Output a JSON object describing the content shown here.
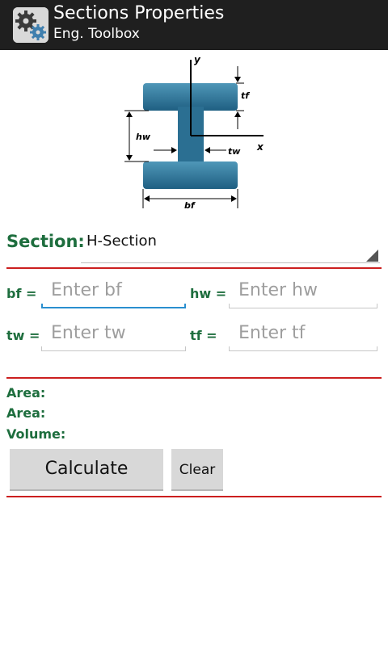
{
  "action_bar": {
    "title": "Sections Properties",
    "subtitle": "Eng. Toolbox",
    "icon": "gears-icon",
    "background": "#1f1f1f"
  },
  "diagram": {
    "labels": {
      "y": "y",
      "x": "x",
      "tf": "tf",
      "hw": "hw",
      "tw": "tw",
      "bf": "bf"
    },
    "fill": "#2b6f92"
  },
  "section": {
    "label": "Section:",
    "selected": "H-Section"
  },
  "inputs": {
    "bf": {
      "label": "bf =",
      "placeholder": "Enter bf"
    },
    "hw": {
      "label": "hw =",
      "placeholder": "Enter hw"
    },
    "tw": {
      "label": "tw =",
      "placeholder": "Enter tw"
    },
    "tf": {
      "label": "tf =",
      "placeholder": "Enter tf"
    }
  },
  "results": {
    "area1": "Area:",
    "area2": "Area:",
    "volume": "Volume:"
  },
  "buttons": {
    "calculate": "Calculate",
    "clear": "Clear"
  },
  "colors": {
    "label_green": "#1e6e3e",
    "rule_red": "#cc1f1f",
    "focus_blue": "#2a8fcf"
  }
}
